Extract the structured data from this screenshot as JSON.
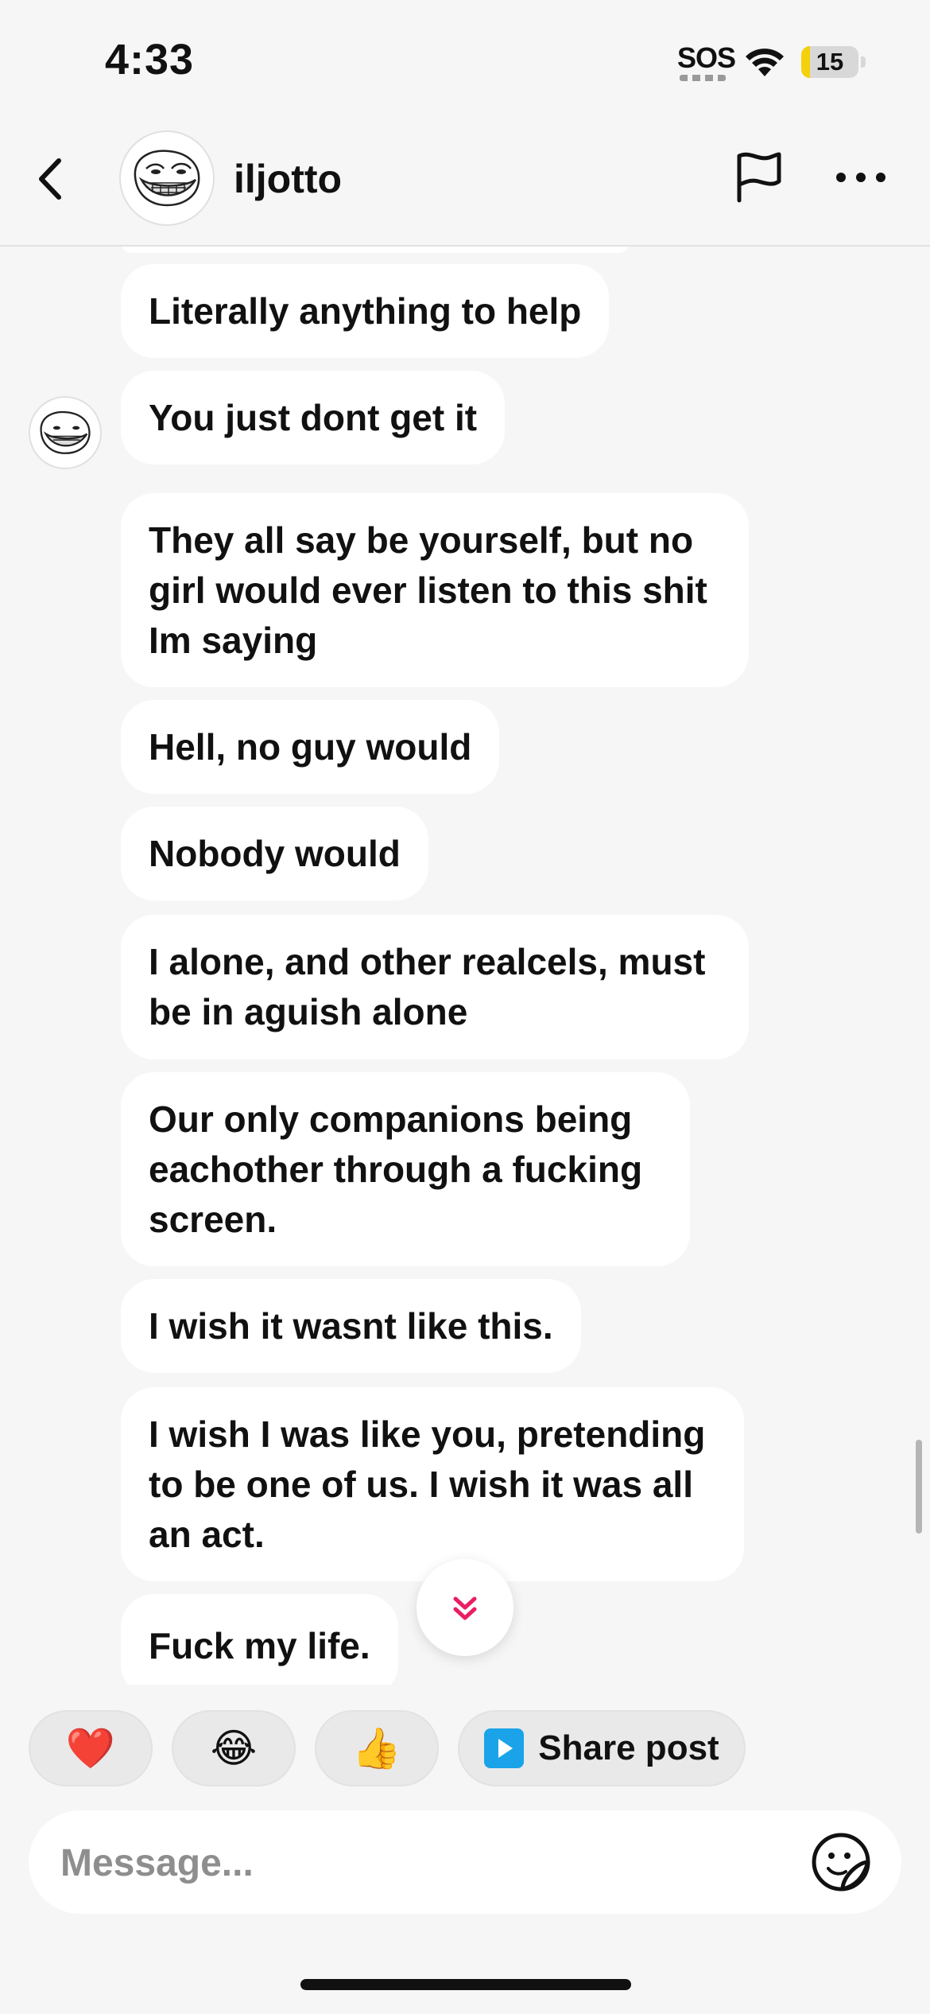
{
  "status_bar": {
    "time": "4:33",
    "sos": "SOS",
    "battery": "15",
    "battery_level_percent": 15,
    "battery_color": "#f4d10b",
    "wifi_icon": "wifi-icon"
  },
  "header": {
    "username": "iljotto",
    "avatar": "trollface-avatar",
    "back_icon": "chevron-left-icon",
    "report_icon": "flag-icon",
    "more_icon": "more-horizontal-icon"
  },
  "messages": [
    {
      "text": "Literally anything to help"
    },
    {
      "text": "You just dont get it",
      "show_avatar": true
    },
    {
      "text": "They all say be yourself, but no girl would ever listen to this shit Im saying"
    },
    {
      "text": "Hell, no guy would"
    },
    {
      "text": "Nobody would"
    },
    {
      "text": "I alone, and other realcels, must be in aguish alone"
    },
    {
      "text": "Our only companions being eachother through a fucking screen."
    },
    {
      "text": "I wish it wasnt like this."
    },
    {
      "text": "I wish I was like you, pretending to be one of us. I wish it was all an act."
    },
    {
      "text": "Fuck my life."
    }
  ],
  "quick_replies": {
    "heart": "❤️",
    "laugh": "😂",
    "thumbs_up": "👍",
    "share_post": "Share post"
  },
  "composer": {
    "placeholder": "Message...",
    "sticker_icon": "sticker-smile-icon"
  },
  "colors": {
    "background": "#f6f6f6",
    "bubble": "#ffffff",
    "accent": "#e91e63",
    "share_icon": "#1aa3e8"
  }
}
